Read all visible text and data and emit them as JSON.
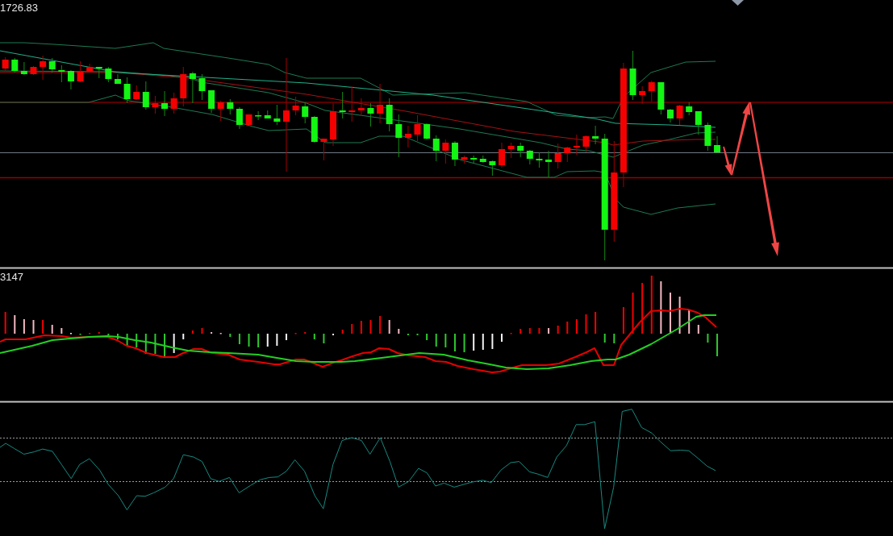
{
  "price_panel": {
    "price_label": "1726.83"
  },
  "macd_panel": {
    "value_label": "3147"
  }
}
